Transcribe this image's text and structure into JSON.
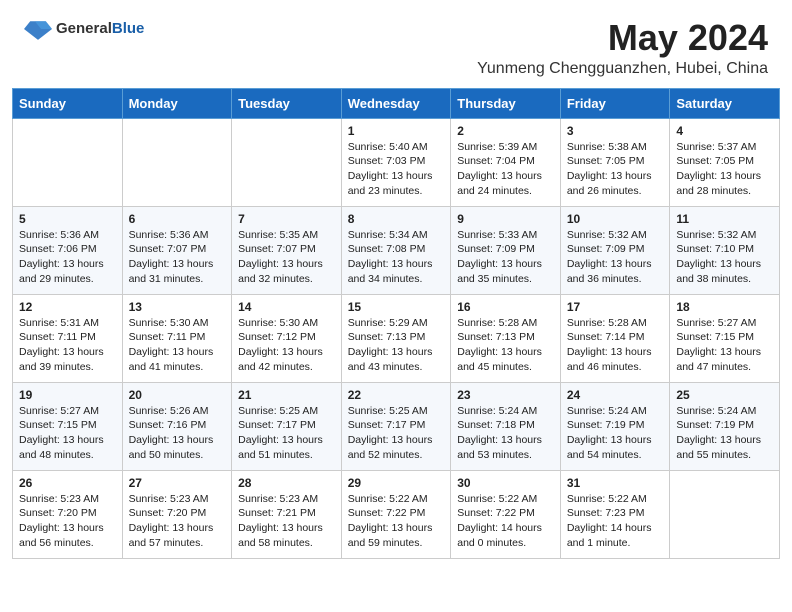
{
  "header": {
    "logo_general": "General",
    "logo_blue": "Blue",
    "month_title": "May 2024",
    "location": "Yunmeng Chengguanzhen, Hubei, China"
  },
  "weekdays": [
    "Sunday",
    "Monday",
    "Tuesday",
    "Wednesday",
    "Thursday",
    "Friday",
    "Saturday"
  ],
  "weeks": [
    [
      {
        "day": "",
        "sunrise": "",
        "sunset": "",
        "daylight": ""
      },
      {
        "day": "",
        "sunrise": "",
        "sunset": "",
        "daylight": ""
      },
      {
        "day": "",
        "sunrise": "",
        "sunset": "",
        "daylight": ""
      },
      {
        "day": "1",
        "sunrise": "Sunrise: 5:40 AM",
        "sunset": "Sunset: 7:03 PM",
        "daylight": "Daylight: 13 hours and 23 minutes."
      },
      {
        "day": "2",
        "sunrise": "Sunrise: 5:39 AM",
        "sunset": "Sunset: 7:04 PM",
        "daylight": "Daylight: 13 hours and 24 minutes."
      },
      {
        "day": "3",
        "sunrise": "Sunrise: 5:38 AM",
        "sunset": "Sunset: 7:05 PM",
        "daylight": "Daylight: 13 hours and 26 minutes."
      },
      {
        "day": "4",
        "sunrise": "Sunrise: 5:37 AM",
        "sunset": "Sunset: 7:05 PM",
        "daylight": "Daylight: 13 hours and 28 minutes."
      }
    ],
    [
      {
        "day": "5",
        "sunrise": "Sunrise: 5:36 AM",
        "sunset": "Sunset: 7:06 PM",
        "daylight": "Daylight: 13 hours and 29 minutes."
      },
      {
        "day": "6",
        "sunrise": "Sunrise: 5:36 AM",
        "sunset": "Sunset: 7:07 PM",
        "daylight": "Daylight: 13 hours and 31 minutes."
      },
      {
        "day": "7",
        "sunrise": "Sunrise: 5:35 AM",
        "sunset": "Sunset: 7:07 PM",
        "daylight": "Daylight: 13 hours and 32 minutes."
      },
      {
        "day": "8",
        "sunrise": "Sunrise: 5:34 AM",
        "sunset": "Sunset: 7:08 PM",
        "daylight": "Daylight: 13 hours and 34 minutes."
      },
      {
        "day": "9",
        "sunrise": "Sunrise: 5:33 AM",
        "sunset": "Sunset: 7:09 PM",
        "daylight": "Daylight: 13 hours and 35 minutes."
      },
      {
        "day": "10",
        "sunrise": "Sunrise: 5:32 AM",
        "sunset": "Sunset: 7:09 PM",
        "daylight": "Daylight: 13 hours and 36 minutes."
      },
      {
        "day": "11",
        "sunrise": "Sunrise: 5:32 AM",
        "sunset": "Sunset: 7:10 PM",
        "daylight": "Daylight: 13 hours and 38 minutes."
      }
    ],
    [
      {
        "day": "12",
        "sunrise": "Sunrise: 5:31 AM",
        "sunset": "Sunset: 7:11 PM",
        "daylight": "Daylight: 13 hours and 39 minutes."
      },
      {
        "day": "13",
        "sunrise": "Sunrise: 5:30 AM",
        "sunset": "Sunset: 7:11 PM",
        "daylight": "Daylight: 13 hours and 41 minutes."
      },
      {
        "day": "14",
        "sunrise": "Sunrise: 5:30 AM",
        "sunset": "Sunset: 7:12 PM",
        "daylight": "Daylight: 13 hours and 42 minutes."
      },
      {
        "day": "15",
        "sunrise": "Sunrise: 5:29 AM",
        "sunset": "Sunset: 7:13 PM",
        "daylight": "Daylight: 13 hours and 43 minutes."
      },
      {
        "day": "16",
        "sunrise": "Sunrise: 5:28 AM",
        "sunset": "Sunset: 7:13 PM",
        "daylight": "Daylight: 13 hours and 45 minutes."
      },
      {
        "day": "17",
        "sunrise": "Sunrise: 5:28 AM",
        "sunset": "Sunset: 7:14 PM",
        "daylight": "Daylight: 13 hours and 46 minutes."
      },
      {
        "day": "18",
        "sunrise": "Sunrise: 5:27 AM",
        "sunset": "Sunset: 7:15 PM",
        "daylight": "Daylight: 13 hours and 47 minutes."
      }
    ],
    [
      {
        "day": "19",
        "sunrise": "Sunrise: 5:27 AM",
        "sunset": "Sunset: 7:15 PM",
        "daylight": "Daylight: 13 hours and 48 minutes."
      },
      {
        "day": "20",
        "sunrise": "Sunrise: 5:26 AM",
        "sunset": "Sunset: 7:16 PM",
        "daylight": "Daylight: 13 hours and 50 minutes."
      },
      {
        "day": "21",
        "sunrise": "Sunrise: 5:25 AM",
        "sunset": "Sunset: 7:17 PM",
        "daylight": "Daylight: 13 hours and 51 minutes."
      },
      {
        "day": "22",
        "sunrise": "Sunrise: 5:25 AM",
        "sunset": "Sunset: 7:17 PM",
        "daylight": "Daylight: 13 hours and 52 minutes."
      },
      {
        "day": "23",
        "sunrise": "Sunrise: 5:24 AM",
        "sunset": "Sunset: 7:18 PM",
        "daylight": "Daylight: 13 hours and 53 minutes."
      },
      {
        "day": "24",
        "sunrise": "Sunrise: 5:24 AM",
        "sunset": "Sunset: 7:19 PM",
        "daylight": "Daylight: 13 hours and 54 minutes."
      },
      {
        "day": "25",
        "sunrise": "Sunrise: 5:24 AM",
        "sunset": "Sunset: 7:19 PM",
        "daylight": "Daylight: 13 hours and 55 minutes."
      }
    ],
    [
      {
        "day": "26",
        "sunrise": "Sunrise: 5:23 AM",
        "sunset": "Sunset: 7:20 PM",
        "daylight": "Daylight: 13 hours and 56 minutes."
      },
      {
        "day": "27",
        "sunrise": "Sunrise: 5:23 AM",
        "sunset": "Sunset: 7:20 PM",
        "daylight": "Daylight: 13 hours and 57 minutes."
      },
      {
        "day": "28",
        "sunrise": "Sunrise: 5:23 AM",
        "sunset": "Sunset: 7:21 PM",
        "daylight": "Daylight: 13 hours and 58 minutes."
      },
      {
        "day": "29",
        "sunrise": "Sunrise: 5:22 AM",
        "sunset": "Sunset: 7:22 PM",
        "daylight": "Daylight: 13 hours and 59 minutes."
      },
      {
        "day": "30",
        "sunrise": "Sunrise: 5:22 AM",
        "sunset": "Sunset: 7:22 PM",
        "daylight": "Daylight: 14 hours and 0 minutes."
      },
      {
        "day": "31",
        "sunrise": "Sunrise: 5:22 AM",
        "sunset": "Sunset: 7:23 PM",
        "daylight": "Daylight: 14 hours and 1 minute."
      },
      {
        "day": "",
        "sunrise": "",
        "sunset": "",
        "daylight": ""
      }
    ]
  ]
}
